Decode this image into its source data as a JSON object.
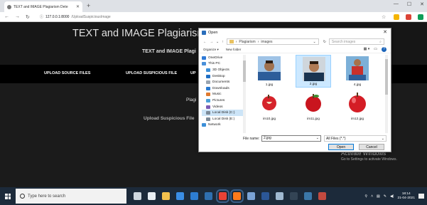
{
  "browser": {
    "tab_title": "TEXT and IMAGE Plagiarism Dete",
    "new_tab": "+",
    "url_host": "127.0.0.1:8000",
    "url_path": "/UploadSuspiciousImage",
    "ext_colors": [
      "#f4b400",
      "#db4437",
      "#0f9d58"
    ]
  },
  "page": {
    "title": "TEXT and IMAGE Plagiarism Detec",
    "subtitle": "TEXT and IMAGE Plagi",
    "nav": [
      "UPLOAD SOURCE FILES",
      "UPLOAD SUSPICIOUS FILE",
      "UP"
    ],
    "plag_label": "Plagi",
    "upload_suspicious_label": "Upload Suspicious File"
  },
  "dialog": {
    "title": "Open",
    "breadcrumb": [
      "Plagiarism",
      "images"
    ],
    "search_placeholder": "Search images",
    "organize": "Organize ▾",
    "new_folder": "New folder",
    "sidebar": [
      {
        "label": "OneDrive",
        "color": "#2f7ad6",
        "sub": false
      },
      {
        "label": "This PC",
        "color": "#4a90d9",
        "sub": false
      },
      {
        "label": "3D Objects",
        "color": "#3c8fd8",
        "sub": true
      },
      {
        "label": "Desktop",
        "color": "#1f6fc5",
        "sub": true
      },
      {
        "label": "Documents",
        "color": "#9aa5b1",
        "sub": true
      },
      {
        "label": "Downloads",
        "color": "#2a7ad0",
        "sub": true
      },
      {
        "label": "Music",
        "color": "#e07a2e",
        "sub": true
      },
      {
        "label": "Pictures",
        "color": "#4a9fd8",
        "sub": true
      },
      {
        "label": "Videos",
        "color": "#7b5bb5",
        "sub": true
      },
      {
        "label": "Local Disk (C:)",
        "color": "#7d8b99",
        "sub": true
      },
      {
        "label": "Local Disk (E:)",
        "color": "#7d8b99",
        "sub": true
      },
      {
        "label": "Network",
        "color": "#3c8fd8",
        "sub": false
      }
    ],
    "files": [
      {
        "name": "1.jpg",
        "kind": "person-blue"
      },
      {
        "name": "2.jpg",
        "kind": "person-dark",
        "selected": true
      },
      {
        "name": "4.jpg",
        "kind": "player"
      },
      {
        "name": "im10.jpg",
        "kind": "apple-cut"
      },
      {
        "name": "im11.jpg",
        "kind": "apple"
      },
      {
        "name": "im12.jpg",
        "kind": "apple-big"
      },
      {
        "name": "",
        "kind": "partial-1"
      },
      {
        "name": "",
        "kind": "partial-2"
      },
      {
        "name": "",
        "kind": "partial-3"
      }
    ],
    "filename_label": "File name:",
    "filename_value": "2.jpg",
    "filetype_value": "All Files (*.*)",
    "open_label": "Open",
    "cancel_label": "Cancel"
  },
  "watermark": {
    "line1": "Activate Windows",
    "line2": "Go to Settings to activate Windows."
  },
  "taskbar": {
    "search_placeholder": "Type here to search",
    "icons": [
      {
        "name": "cortana-icon",
        "color": "#cfd8e0"
      },
      {
        "name": "task-view-icon",
        "color": "#e8eef3"
      },
      {
        "name": "file-explorer-icon",
        "color": "#f2c14e"
      },
      {
        "name": "store-icon",
        "color": "#3a8ee6"
      },
      {
        "name": "edge-icon",
        "color": "#2d7dd2"
      },
      {
        "name": "mail-icon",
        "color": "#2f6fb0"
      },
      {
        "name": "chrome-icon",
        "color": "#e94235",
        "active": true
      },
      {
        "name": "firefox-icon",
        "color": "#ff7a1a",
        "active": true
      },
      {
        "name": "photos-icon",
        "color": "#7aa3d6"
      },
      {
        "name": "word-icon",
        "color": "#2b5797"
      },
      {
        "name": "notepad-icon",
        "color": "#9fb8d0"
      },
      {
        "name": "terminal-icon",
        "color": "#345"
      },
      {
        "name": "python-icon",
        "color": "#3b77a8"
      },
      {
        "name": "app-icon",
        "color": "#c24a3f"
      }
    ],
    "time": "18:14",
    "date": "21-04-2021"
  }
}
